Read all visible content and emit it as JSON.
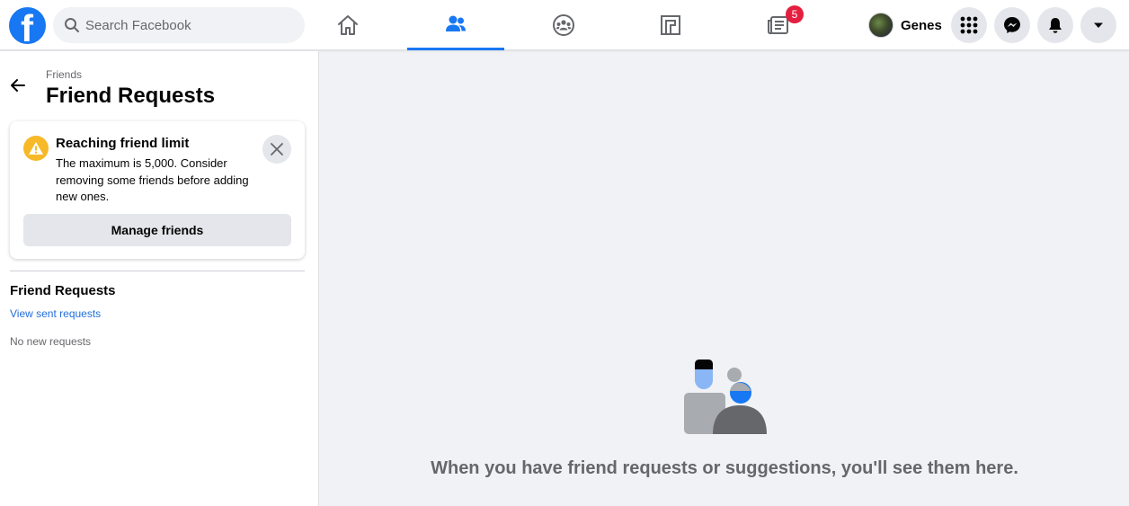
{
  "header": {
    "logo_letter": "f",
    "search": {
      "placeholder": "Search Facebook"
    },
    "nav": [
      {
        "name": "home",
        "icon": "home-icon"
      },
      {
        "name": "friends",
        "icon": "friends-icon",
        "active": true
      },
      {
        "name": "groups",
        "icon": "groups-icon"
      },
      {
        "name": "gaming",
        "icon": "gaming-icon"
      },
      {
        "name": "news",
        "icon": "news-feed-icon",
        "badge": "5"
      }
    ],
    "profile_name": "Genes",
    "buttons": [
      "menu-grid-icon",
      "messenger-icon",
      "notifications-bell-icon",
      "account-caret-icon"
    ]
  },
  "sidebar": {
    "breadcrumb": "Friends",
    "title": "Friend Requests",
    "alert": {
      "title": "Reaching friend limit",
      "body": "The maximum is 5,000. Consider removing some friends before adding new ones.",
      "button": "Manage friends"
    },
    "section_title": "Friend Requests",
    "sent_link": "View sent requests",
    "empty": "No new requests"
  },
  "main": {
    "empty_message": "When you have friend requests or suggestions, you'll see them here."
  },
  "colors": {
    "brand": "#1877f2",
    "badge": "#e41e3f",
    "warning": "#f7b928",
    "link": "#216fdb"
  }
}
